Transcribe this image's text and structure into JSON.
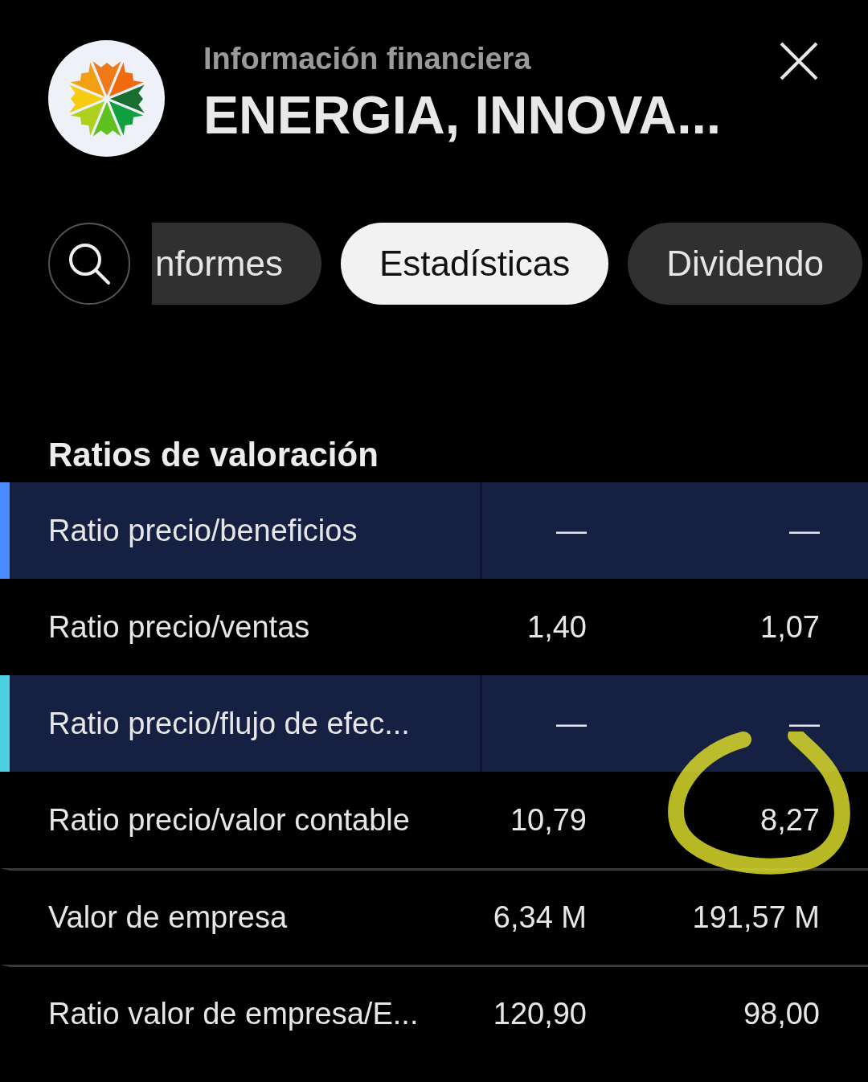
{
  "header": {
    "subtitle": "Información financiera",
    "title": "ENERGIA, INNOVA..."
  },
  "tabs": [
    {
      "label": "nformes",
      "selected": false
    },
    {
      "label": "Estadísticas",
      "selected": true
    },
    {
      "label": "Dividendo",
      "selected": false
    }
  ],
  "section": {
    "title": "Ratios de valoración"
  },
  "rows": [
    {
      "label": "Ratio precio/beneficios",
      "value_1": "—",
      "value_2": "—",
      "highlighted": true,
      "color": "#4a8cff"
    },
    {
      "label": "Ratio precio/ventas",
      "value_1": "1,40",
      "value_2": "1,07",
      "highlighted": false
    },
    {
      "label": "Ratio precio/flujo de efec...",
      "value_1": "—",
      "value_2": "—",
      "highlighted": true,
      "color": "#4dd0e1"
    },
    {
      "label": "Ratio precio/valor contable",
      "value_1": "10,79",
      "value_2": "8,27",
      "highlighted": false
    },
    {
      "label": "Valor de empresa",
      "value_1": "6,34 M",
      "value_2": "191,57 M",
      "highlighted": false
    },
    {
      "label": "Ratio valor de empresa/E...",
      "value_1": "120,90",
      "value_2": "98,00",
      "highlighted": false
    }
  ]
}
